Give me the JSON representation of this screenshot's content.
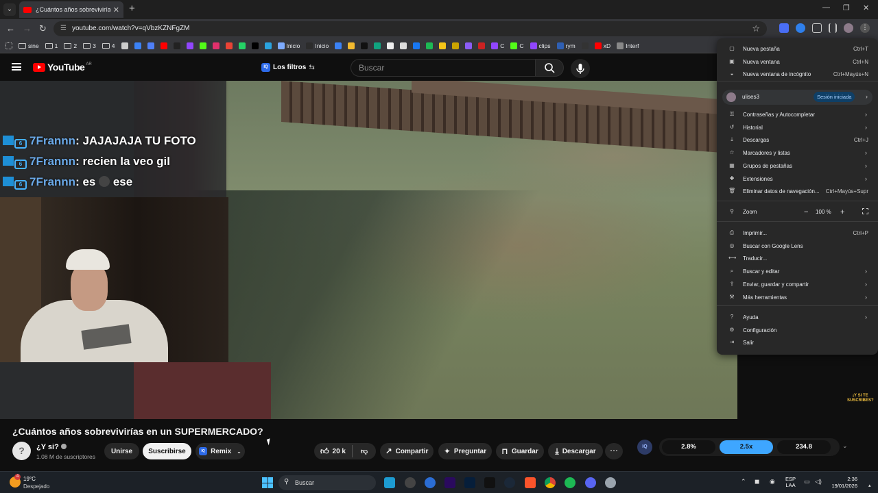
{
  "browser": {
    "tab_title": "¿Cuántos años sobrevivirías en",
    "url": "youtube.com/watch?v=qVbzKZNFgZM",
    "bookmarks": [
      {
        "label": "sine",
        "icon": "folder-icon"
      },
      {
        "label": "1",
        "icon": "folder-icon"
      },
      {
        "label": "2",
        "icon": "folder-icon"
      },
      {
        "label": "3",
        "icon": "folder-icon"
      },
      {
        "label": "4",
        "icon": "folder-icon"
      },
      {
        "label": "",
        "icon": "openai-icon",
        "color": "#cccccc"
      },
      {
        "label": "",
        "icon": "compass-icon",
        "color": "#3b82f6"
      },
      {
        "label": "",
        "icon": "translate-icon",
        "color": "#4f7ff7"
      },
      {
        "label": "",
        "icon": "youtube-icon",
        "color": "#ff0000"
      },
      {
        "label": "",
        "icon": "tiktok-icon",
        "color": "#222222"
      },
      {
        "label": "",
        "icon": "twitch-icon",
        "color": "#9146ff"
      },
      {
        "label": "",
        "icon": "kick-icon",
        "color": "#53fc18"
      },
      {
        "label": "",
        "icon": "instagram-icon",
        "color": "#e1306c"
      },
      {
        "label": "",
        "icon": "gmail-icon",
        "color": "#ea4335"
      },
      {
        "label": "",
        "icon": "whatsapp-icon",
        "color": "#25d366"
      },
      {
        "label": "",
        "icon": "x-icon",
        "color": "#000000"
      },
      {
        "label": "",
        "icon": "telegram-icon",
        "color": "#2aa3df"
      },
      {
        "label": "Inicio",
        "icon": "home-app-icon",
        "color": "#7dabff"
      },
      {
        "label": "Inicio",
        "icon": "home-app2-icon",
        "color": "#2c2c2c"
      },
      {
        "label": "",
        "icon": "app-icon",
        "color": "#3b82f6"
      },
      {
        "label": "",
        "icon": "binance-icon",
        "color": "#f3ba2f"
      },
      {
        "label": "",
        "icon": "x-app-icon",
        "color": "#111111"
      },
      {
        "label": "",
        "icon": "chatgpt-icon",
        "color": "#10a37f"
      },
      {
        "label": "",
        "icon": "app-a-icon",
        "color": "#eeeeee"
      },
      {
        "label": "",
        "icon": "app-b-icon",
        "color": "#dddddd"
      },
      {
        "label": "",
        "icon": "facebook-icon",
        "color": "#1877f2"
      },
      {
        "label": "",
        "icon": "spotify-icon",
        "color": "#1db954"
      },
      {
        "label": "",
        "icon": "b-icon",
        "color": "#f5c518"
      },
      {
        "label": "",
        "icon": "crown-icon",
        "color": "#caa400"
      },
      {
        "label": "",
        "icon": "proton-icon",
        "color": "#8b5cf6"
      },
      {
        "label": "",
        "icon": "pin-icon",
        "color": "#cc2222"
      },
      {
        "label": "C",
        "icon": "twitch-c-icon",
        "color": "#9146ff"
      },
      {
        "label": "C",
        "icon": "kick-c-icon",
        "color": "#53fc18"
      },
      {
        "label": "clips",
        "icon": "twitch-clips-icon",
        "color": "#9146ff"
      },
      {
        "label": "rym",
        "icon": "rym-icon",
        "color": "#2f5fb3"
      },
      {
        "label": "",
        "icon": "circle-icon",
        "color": "#333333"
      },
      {
        "label": "xD",
        "icon": "yt-xd-icon",
        "color": "#ff0000"
      },
      {
        "label": "Interf",
        "icon": "line-icon",
        "color": "#888888"
      }
    ]
  },
  "youtube": {
    "logo_text": "YouTube",
    "country": "AR",
    "filters_label": "Los filtros",
    "iq_badge": "IQ",
    "search_placeholder": "Buscar"
  },
  "chat": [
    {
      "user": "7Frannn",
      "text": ": JAJAJAJA TU FOTO"
    },
    {
      "user": "7Frannn",
      "text": ": recien la veo gil"
    },
    {
      "user": "7Frannn",
      "text_a": ": es",
      "text_b": "ese"
    }
  ],
  "sticker": "¡Y SI TE\nSUSCRIBES?",
  "video": {
    "title": "¿Cuántos años sobrevivirías en un SUPERMERCADO?",
    "channel": "¿Y si?",
    "subscribers": "1.08 M de suscriptores",
    "join_label": "Unirse",
    "subscribe_label": "Suscribirse",
    "remix_label": "Remix",
    "likes": "20 k",
    "share_label": "Compartir",
    "ask_label": "Preguntar",
    "save_label": "Guardar",
    "download_label": "Descargar"
  },
  "iq_panel": {
    "logo": "IQ",
    "values": [
      "2.8%",
      "2.5x",
      "234.8"
    ]
  },
  "menu": {
    "items_top": [
      {
        "label": "Nueva pestaña",
        "shortcut": "Ctrl+T",
        "icon": "new-tab-icon"
      },
      {
        "label": "Nueva ventana",
        "shortcut": "Ctrl+N",
        "icon": "new-window-icon"
      },
      {
        "label": "Nueva ventana de incógnito",
        "shortcut": "Ctrl+Mayús+N",
        "icon": "incognito-icon"
      }
    ],
    "profile": {
      "name": "ulises3",
      "status": "Sesión iniciada"
    },
    "items_mid": [
      {
        "label": "Contraseñas y Autocompletar",
        "shortcut": "",
        "arrow": true,
        "icon": "key-icon"
      },
      {
        "label": "Historial",
        "shortcut": "",
        "arrow": true,
        "icon": "history-icon"
      },
      {
        "label": "Descargas",
        "shortcut": "Ctrl+J",
        "arrow": false,
        "icon": "download-icon"
      },
      {
        "label": "Marcadores y listas",
        "shortcut": "",
        "arrow": true,
        "icon": "star-icon"
      },
      {
        "label": "Grupos de pestañas",
        "shortcut": "",
        "arrow": true,
        "icon": "tab-groups-icon"
      },
      {
        "label": "Extensiones",
        "shortcut": "",
        "arrow": true,
        "icon": "extension-icon"
      },
      {
        "label": "Eliminar datos de navegación...",
        "shortcut": "Ctrl+Mayús+Supr",
        "arrow": false,
        "icon": "trash-icon"
      }
    ],
    "zoom": {
      "label": "Zoom",
      "value": "100 %",
      "minus": "−",
      "plus": "+"
    },
    "items_tools": [
      {
        "label": "Imprimir...",
        "shortcut": "Ctrl+P",
        "arrow": false,
        "icon": "print-icon"
      },
      {
        "label": "Buscar con Google Lens",
        "shortcut": "",
        "arrow": false,
        "icon": "lens-icon"
      },
      {
        "label": "Traducir...",
        "shortcut": "",
        "arrow": false,
        "icon": "translate-icon"
      },
      {
        "label": "Buscar y editar",
        "shortcut": "",
        "arrow": true,
        "icon": "search-edit-icon"
      },
      {
        "label": "Enviar, guardar y compartir",
        "shortcut": "",
        "arrow": true,
        "icon": "share-icon"
      },
      {
        "label": "Más herramientas",
        "shortcut": "",
        "arrow": true,
        "icon": "tools-icon"
      }
    ],
    "items_bottom": [
      {
        "label": "Ayuda",
        "shortcut": "",
        "arrow": true,
        "icon": "help-icon"
      },
      {
        "label": "Configuración",
        "shortcut": "",
        "arrow": false,
        "icon": "settings-icon"
      },
      {
        "label": "Salir",
        "shortcut": "",
        "arrow": false,
        "icon": "exit-icon"
      }
    ]
  },
  "taskbar": {
    "weather_badge": "4",
    "temperature": "19°C",
    "weather": "Despejado",
    "search_label": "Buscar",
    "lang_top": "ESP",
    "lang_bottom": "LAA",
    "time": "2:36",
    "date": "19/01/2026"
  }
}
